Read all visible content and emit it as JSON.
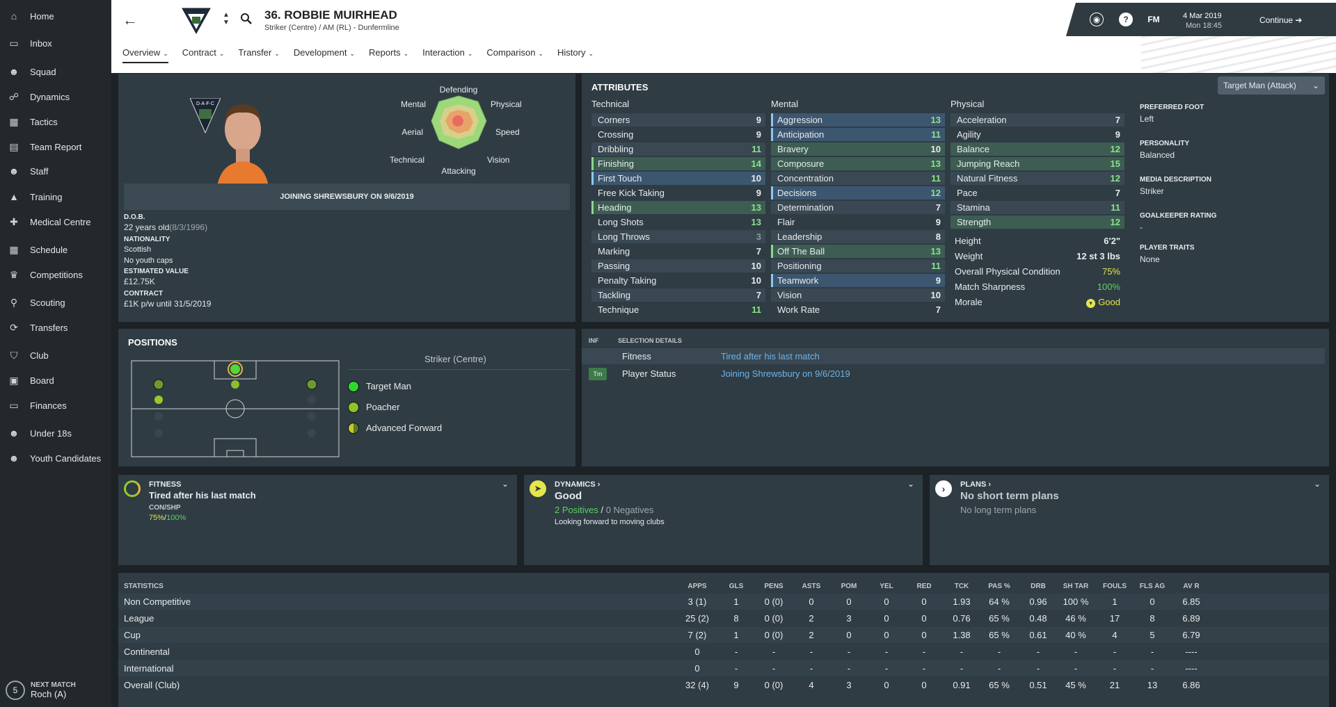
{
  "sidebar": {
    "items": [
      {
        "label": "Home",
        "icon": "home-icon"
      },
      {
        "label": "Inbox",
        "icon": "inbox-icon"
      },
      {
        "label": "Squad",
        "icon": "squad-icon"
      },
      {
        "label": "Dynamics",
        "icon": "dynamics-icon"
      },
      {
        "label": "Tactics",
        "icon": "tactics-icon"
      },
      {
        "label": "Team Report",
        "icon": "report-icon"
      },
      {
        "label": "Staff",
        "icon": "staff-icon"
      },
      {
        "label": "Training",
        "icon": "training-icon"
      },
      {
        "label": "Medical Centre",
        "icon": "medical-icon"
      },
      {
        "label": "Schedule",
        "icon": "calendar-icon"
      },
      {
        "label": "Competitions",
        "icon": "trophy-icon"
      },
      {
        "label": "Scouting",
        "icon": "search-icon"
      },
      {
        "label": "Transfers",
        "icon": "transfer-icon"
      },
      {
        "label": "Club",
        "icon": "shield-icon"
      },
      {
        "label": "Board",
        "icon": "briefcase-icon"
      },
      {
        "label": "Finances",
        "icon": "money-icon"
      },
      {
        "label": "Under 18s",
        "icon": "u18-icon"
      },
      {
        "label": "Youth Candidates",
        "icon": "youth-icon"
      }
    ],
    "next_match": {
      "label": "NEXT MATCH",
      "value": "Roch (A)",
      "count": "5"
    }
  },
  "header": {
    "player_name": "36. ROBBIE MUIRHEAD",
    "player_sub": "Striker (Centre) / AM (RL) - Dunfermline",
    "crest_text": "D·A·F·C",
    "tabs": [
      {
        "label": "Overview"
      },
      {
        "label": "Contract"
      },
      {
        "label": "Transfer"
      },
      {
        "label": "Development"
      },
      {
        "label": "Reports"
      },
      {
        "label": "Interaction"
      },
      {
        "label": "Comparison"
      },
      {
        "label": "History"
      }
    ],
    "fm_label": "FM",
    "date": "4 Mar 2019",
    "time": "Mon 18:45",
    "continue": "Continue"
  },
  "profile": {
    "crest_text": "D·A·F·C",
    "radar_labels": {
      "defending": "Defending",
      "physical": "Physical",
      "speed": "Speed",
      "vision": "Vision",
      "attacking": "Attacking",
      "technical": "Technical",
      "aerial": "Aerial",
      "mental": "Mental"
    },
    "status_banner": "JOINING SHREWSBURY ON 9/6/2019",
    "dob_label": "D.O.B.",
    "dob_value": "22 years old",
    "dob_date": "(8/3/1996)",
    "nationality_label": "NATIONALITY",
    "nationality_value": "Scottish",
    "caps": "No youth caps",
    "value_label": "ESTIMATED VALUE",
    "value_value": "£12.75K",
    "contract_label": "CONTRACT",
    "contract_value": "£1K p/w until 31/5/2019"
  },
  "attributes": {
    "title": "ATTRIBUTES",
    "role_select": "Target Man (Attack)",
    "technical_header": "Technical",
    "mental_header": "Mental",
    "physical_header": "Physical",
    "technical": [
      {
        "name": "Corners",
        "value": "9"
      },
      {
        "name": "Crossing",
        "value": "9"
      },
      {
        "name": "Dribbling",
        "value": "11"
      },
      {
        "name": "Finishing",
        "value": "14"
      },
      {
        "name": "First Touch",
        "value": "10"
      },
      {
        "name": "Free Kick Taking",
        "value": "9"
      },
      {
        "name": "Heading",
        "value": "13"
      },
      {
        "name": "Long Shots",
        "value": "13"
      },
      {
        "name": "Long Throws",
        "value": "3"
      },
      {
        "name": "Marking",
        "value": "7"
      },
      {
        "name": "Passing",
        "value": "10"
      },
      {
        "name": "Penalty Taking",
        "value": "10"
      },
      {
        "name": "Tackling",
        "value": "7"
      },
      {
        "name": "Technique",
        "value": "11"
      }
    ],
    "mental": [
      {
        "name": "Aggression",
        "value": "13"
      },
      {
        "name": "Anticipation",
        "value": "11"
      },
      {
        "name": "Bravery",
        "value": "10"
      },
      {
        "name": "Composure",
        "value": "13"
      },
      {
        "name": "Concentration",
        "value": "11"
      },
      {
        "name": "Decisions",
        "value": "12"
      },
      {
        "name": "Determination",
        "value": "7"
      },
      {
        "name": "Flair",
        "value": "9"
      },
      {
        "name": "Leadership",
        "value": "8"
      },
      {
        "name": "Off The Ball",
        "value": "13"
      },
      {
        "name": "Positioning",
        "value": "11"
      },
      {
        "name": "Teamwork",
        "value": "9"
      },
      {
        "name": "Vision",
        "value": "10"
      },
      {
        "name": "Work Rate",
        "value": "7"
      }
    ],
    "physical": [
      {
        "name": "Acceleration",
        "value": "7"
      },
      {
        "name": "Agility",
        "value": "9"
      },
      {
        "name": "Balance",
        "value": "12"
      },
      {
        "name": "Jumping Reach",
        "value": "15"
      },
      {
        "name": "Natural Fitness",
        "value": "12"
      },
      {
        "name": "Pace",
        "value": "7"
      },
      {
        "name": "Stamina",
        "value": "11"
      },
      {
        "name": "Strength",
        "value": "12"
      }
    ],
    "extra": [
      {
        "name": "Height",
        "value": "6'2\""
      },
      {
        "name": "Weight",
        "value": "12 st 3 lbs"
      },
      {
        "name": "Overall Physical Condition",
        "value": "75%"
      },
      {
        "name": "Match Sharpness",
        "value": "100%"
      },
      {
        "name": "Morale",
        "value": "Good"
      }
    ],
    "info": {
      "foot_label": "PREFERRED FOOT",
      "foot_value": "Left",
      "personality_label": "PERSONALITY",
      "personality_value": "Balanced",
      "media_label": "MEDIA DESCRIPTION",
      "media_value": "Striker",
      "gk_label": "GOALKEEPER RATING",
      "gk_value": "-",
      "traits_label": "PLAYER TRAITS",
      "traits_value": "None"
    }
  },
  "positions": {
    "title": "POSITIONS",
    "selected": "Striker (Centre)",
    "roles": [
      {
        "label": "Target Man"
      },
      {
        "label": "Poacher"
      },
      {
        "label": "Advanced Forward"
      }
    ]
  },
  "selection": {
    "inf_header": "INF",
    "details_header": "SELECTION DETAILS",
    "rows": [
      {
        "label": "Fitness",
        "value": "Tired after his last match",
        "badge": ""
      },
      {
        "label": "Player Status",
        "value": "Joining Shrewsbury on 9/6/2019",
        "badge": "Tm"
      }
    ]
  },
  "cards": {
    "fitness": {
      "title": "FITNESS",
      "headline": "Tired after his last match",
      "sub_label": "CON/SHP",
      "con": "75%",
      "slash": "/",
      "shp": "100%"
    },
    "dynamics": {
      "title": "DYNAMICS ›",
      "headline": "Good",
      "positives": "2 Positives",
      "slash": "/",
      "negatives": "0 Negatives",
      "note": "Looking forward to moving clubs"
    },
    "plans": {
      "title": "PLANS ›",
      "headline": "No short term plans",
      "note": "No long term plans"
    }
  },
  "statistics": {
    "title": "STATISTICS",
    "columns": [
      "APPS",
      "GLS",
      "PENS",
      "ASTS",
      "POM",
      "YEL",
      "RED",
      "TCK",
      "PAS %",
      "DRB",
      "SH TAR",
      "FOULS",
      "FLS AG",
      "AV R"
    ],
    "rows": [
      {
        "name": "Non Competitive",
        "cells": [
          "3 (1)",
          "1",
          "0 (0)",
          "0",
          "0",
          "0",
          "0",
          "1.93",
          "64 %",
          "0.96",
          "100 %",
          "1",
          "0",
          "6.85"
        ]
      },
      {
        "name": "League",
        "cells": [
          "25 (2)",
          "8",
          "0 (0)",
          "2",
          "3",
          "0",
          "0",
          "0.76",
          "65 %",
          "0.48",
          "46 %",
          "17",
          "8",
          "6.89"
        ]
      },
      {
        "name": "Cup",
        "cells": [
          "7 (2)",
          "1",
          "0 (0)",
          "2",
          "0",
          "0",
          "0",
          "1.38",
          "65 %",
          "0.61",
          "40 %",
          "4",
          "5",
          "6.79"
        ]
      },
      {
        "name": "Continental",
        "cells": [
          "0",
          "-",
          "-",
          "-",
          "-",
          "-",
          "-",
          "-",
          "-",
          "-",
          "-",
          "-",
          "-",
          "----"
        ]
      },
      {
        "name": "International",
        "cells": [
          "0",
          "-",
          "-",
          "-",
          "-",
          "-",
          "-",
          "-",
          "-",
          "-",
          "-",
          "-",
          "-",
          "----"
        ]
      },
      {
        "name": "Overall (Club)",
        "cells": [
          "32 (4)",
          "9",
          "0 (0)",
          "4",
          "3",
          "0",
          "0",
          "0.91",
          "65 %",
          "0.51",
          "45 %",
          "21",
          "13",
          "6.86"
        ]
      }
    ]
  },
  "colors": {
    "accent_green": "#8be48b",
    "accent_blue": "#6db4e8",
    "panel": "#2f3c44",
    "sidebar": "#23282b",
    "yellow": "#e6e64a"
  }
}
